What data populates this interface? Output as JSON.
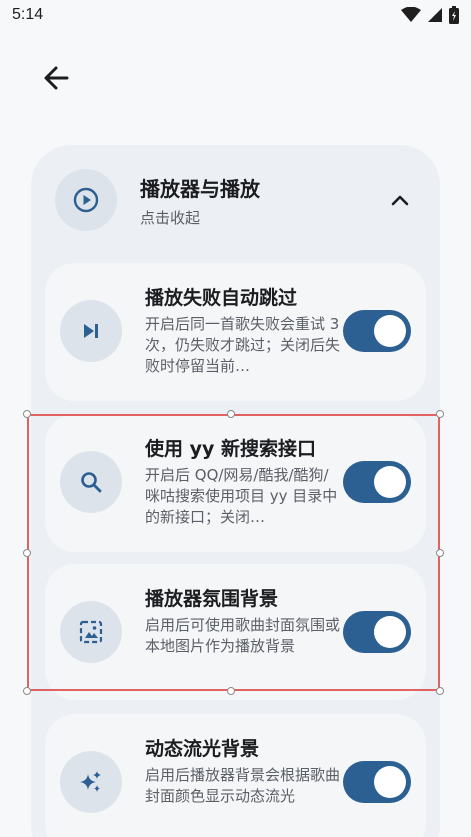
{
  "status_bar": {
    "time": "5:14"
  },
  "group": {
    "title": "播放器与播放",
    "subtitle": "点击收起",
    "icon": "play-circle-icon",
    "expanded": true
  },
  "settings": [
    {
      "icon": "skip-next-icon",
      "title": "播放失败自动跳过",
      "description": "开启后同一首歌失败会重试 3 次，仍失败才跳过；关闭后失败时停留当前…",
      "enabled": true
    },
    {
      "icon": "search-icon",
      "title": "使用 yy 新搜索接口",
      "description": "开启后 QQ/网易/酷我/酷狗/咪咕搜索使用项目 yy 目录中的新接口；关闭…",
      "enabled": true
    },
    {
      "icon": "image-icon",
      "title": "播放器氛围背景",
      "description": "启用后可使用歌曲封面氛围或本地图片作为播放背景",
      "enabled": true
    },
    {
      "icon": "sparkle-icon",
      "title": "动态流光背景",
      "description": "启用后播放器背景会根据歌曲封面颜色显示动态流光",
      "enabled": true
    }
  ],
  "colors": {
    "accent": "#2c5f92",
    "selection_border": "#e06262",
    "card_background": "#f5f6f8",
    "group_background": "#eceff3"
  }
}
